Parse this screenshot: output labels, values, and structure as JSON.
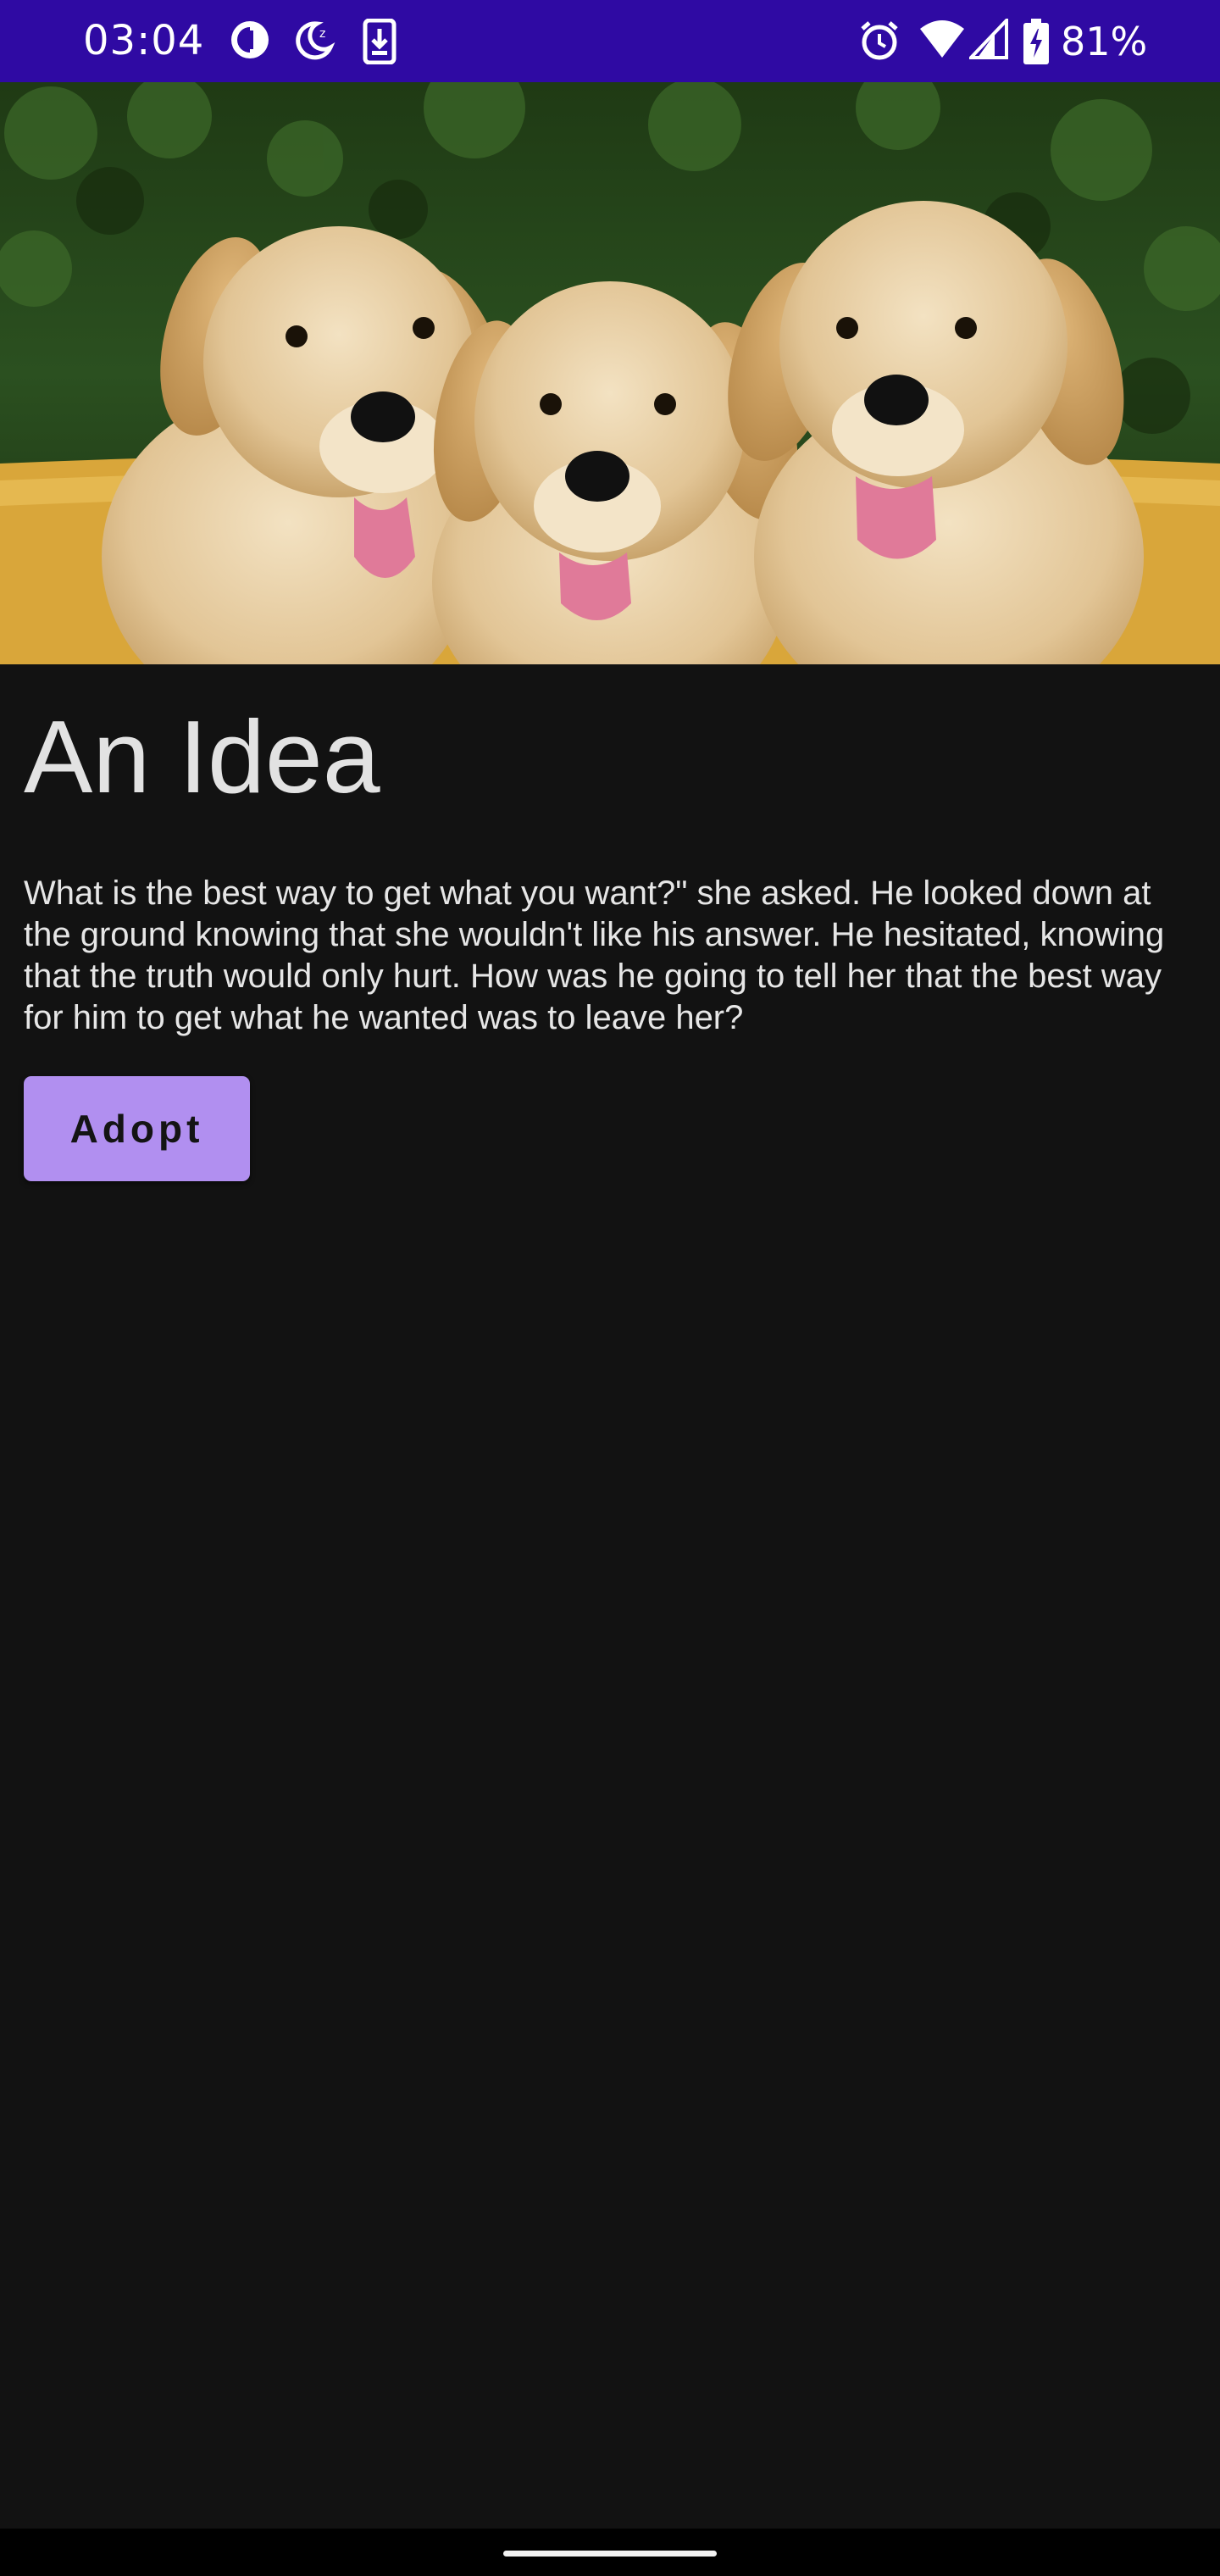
{
  "status_bar": {
    "time": "03:04",
    "battery_percent": "81%",
    "icons": [
      "data-saver-icon",
      "do-not-disturb-icon",
      "download-icon",
      "alarm-icon",
      "wifi-icon",
      "signal-icon",
      "battery-charging-icon"
    ],
    "background_color": "#2f0aa3"
  },
  "hero": {
    "image": "three-golden-retriever-puppies"
  },
  "content": {
    "title": "An Idea",
    "body": "What is the best way to get what you want?\" she asked. He looked down at the ground knowing that she wouldn't like his answer. He hesitated, knowing that the truth would only hurt. How was he going to tell her that the best way for him to get what he wanted was to leave her?",
    "adopt_label": "Adopt"
  },
  "colors": {
    "background": "#121212",
    "accent": "#b18ff0"
  }
}
